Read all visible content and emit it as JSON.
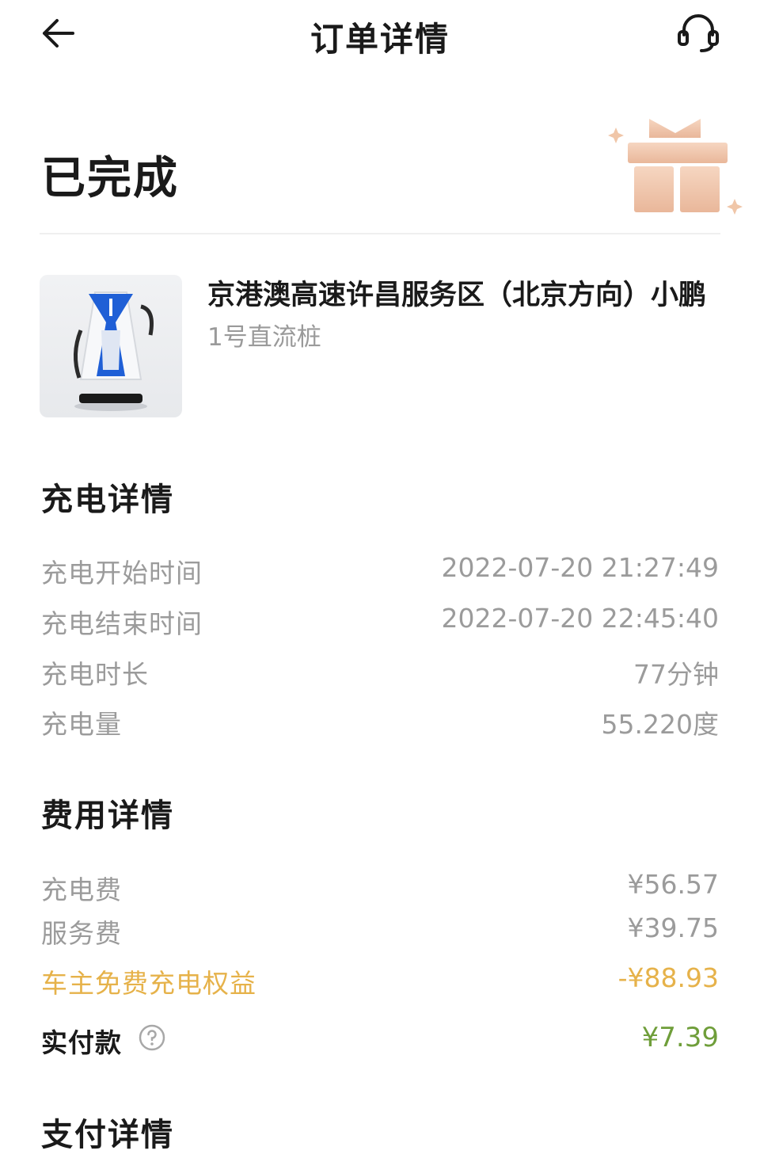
{
  "header": {
    "title": "订单详情",
    "back_icon": "arrow-left-icon",
    "support_icon": "headset-icon"
  },
  "status": {
    "text": "已完成",
    "gift_icon": "gift-icon"
  },
  "station": {
    "name": "京港澳高速许昌服务区（北京方向）小鹏",
    "pile": "1号直流桩"
  },
  "charging_details": {
    "title": "充电详情",
    "rows": [
      {
        "label": "充电开始时间",
        "value": "2022-07-20 21:27:49"
      },
      {
        "label": "充电结束时间",
        "value": "2022-07-20 22:45:40"
      },
      {
        "label": "充电时长",
        "value": "77分钟"
      },
      {
        "label": "充电量",
        "value": "55.220度"
      }
    ]
  },
  "fee_details": {
    "title": "费用详情",
    "rows": [
      {
        "label": "充电费",
        "value": "¥56.57"
      },
      {
        "label": "服务费",
        "value": "¥39.75"
      },
      {
        "label": "车主免费充电权益",
        "value": "-¥88.93"
      }
    ],
    "paid": {
      "label": "实付款",
      "value": "¥7.39"
    }
  },
  "payment_details": {
    "title": "支付详情"
  },
  "colors": {
    "accent": "#e6b24a",
    "paid": "#6f9e3a",
    "muted": "#9b9b9b"
  }
}
